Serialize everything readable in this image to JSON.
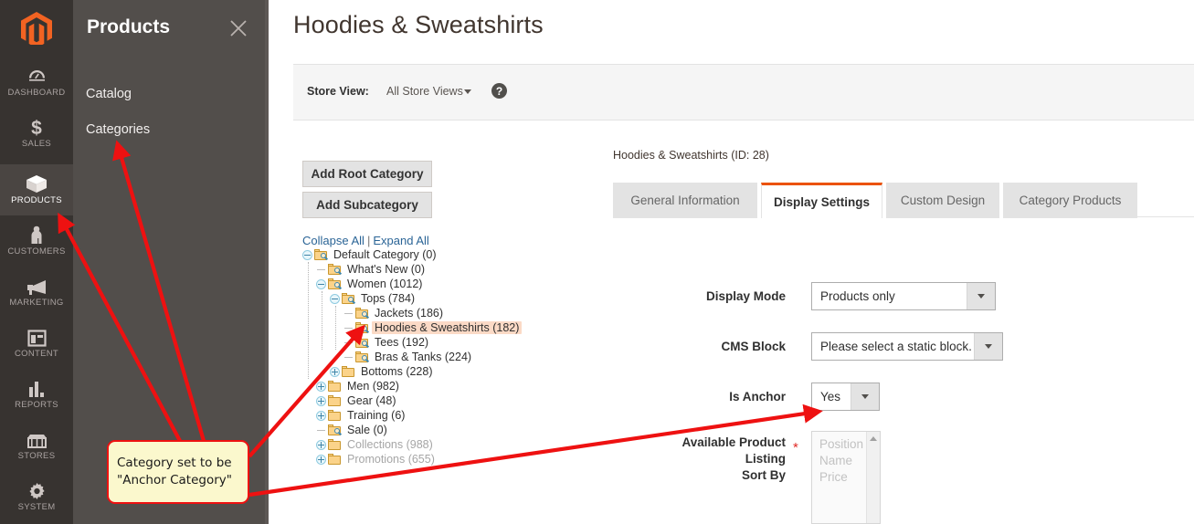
{
  "brand": {
    "accent": "#eb5202",
    "rail_bg": "#373330",
    "flyout_bg": "#524e4b",
    "highlight": "#fbdac6",
    "annotation": "#ee1111"
  },
  "rail": {
    "logo_name": "magento-logo",
    "items": [
      {
        "label": "DASHBOARD",
        "icon": "gauge-icon",
        "active": false
      },
      {
        "label": "SALES",
        "icon": "dollar-icon",
        "active": false
      },
      {
        "label": "PRODUCTS",
        "icon": "box-icon",
        "active": true
      },
      {
        "label": "CUSTOMERS",
        "icon": "person-icon",
        "active": false
      },
      {
        "label": "MARKETING",
        "icon": "megaphone-icon",
        "active": false
      },
      {
        "label": "CONTENT",
        "icon": "layout-icon",
        "active": false
      },
      {
        "label": "REPORTS",
        "icon": "bar-chart-icon",
        "active": false
      },
      {
        "label": "STORES",
        "icon": "storefront-icon",
        "active": false
      },
      {
        "label": "SYSTEM",
        "icon": "gear-icon",
        "active": false
      }
    ]
  },
  "flyout": {
    "title": "Products",
    "close_icon": "close-icon",
    "links": [
      {
        "label": "Catalog"
      },
      {
        "label": "Categories"
      }
    ]
  },
  "header": {
    "page_title": "Hoodies & Sweatshirts",
    "store_view_label": "Store View:",
    "store_view_value": "All Store Views",
    "help_icon": "question-mark-icon",
    "caret_icon": "chevron-down-icon"
  },
  "tree_panel": {
    "add_root_label": "Add Root Category",
    "add_sub_label": "Add Subcategory",
    "collapse_all": "Collapse All",
    "separator": "|",
    "expand_all": "Expand All",
    "nodes": [
      {
        "label": "Default Category (0)",
        "depth": 0,
        "twist": "minus",
        "icon": "folder-search-icon",
        "selected": false,
        "dim": false
      },
      {
        "label": "What's New (0)",
        "depth": 1,
        "twist": "leaf",
        "icon": "folder-search-icon",
        "selected": false,
        "dim": false
      },
      {
        "label": "Women (1012)",
        "depth": 1,
        "twist": "minus",
        "icon": "folder-search-icon",
        "selected": false,
        "dim": false
      },
      {
        "label": "Tops (784)",
        "depth": 2,
        "twist": "minus",
        "icon": "folder-search-icon",
        "selected": false,
        "dim": false
      },
      {
        "label": "Jackets (186)",
        "depth": 3,
        "twist": "leaf",
        "icon": "folder-search-icon",
        "selected": false,
        "dim": false
      },
      {
        "label": "Hoodies & Sweatshirts (182)",
        "depth": 3,
        "twist": "leaf",
        "icon": "folder-search-icon",
        "selected": true,
        "dim": false
      },
      {
        "label": "Tees (192)",
        "depth": 3,
        "twist": "leaf",
        "icon": "folder-search-icon",
        "selected": false,
        "dim": false
      },
      {
        "label": "Bras & Tanks (224)",
        "depth": 3,
        "twist": "leaf",
        "icon": "folder-search-icon",
        "selected": false,
        "dim": false
      },
      {
        "label": "Bottoms (228)",
        "depth": 2,
        "twist": "plus",
        "icon": "folder-icon",
        "selected": false,
        "dim": false
      },
      {
        "label": "Men (982)",
        "depth": 1,
        "twist": "plus",
        "icon": "folder-icon",
        "selected": false,
        "dim": false
      },
      {
        "label": "Gear (48)",
        "depth": 1,
        "twist": "plus",
        "icon": "folder-icon",
        "selected": false,
        "dim": false
      },
      {
        "label": "Training (6)",
        "depth": 1,
        "twist": "plus",
        "icon": "folder-icon",
        "selected": false,
        "dim": false
      },
      {
        "label": "Sale (0)",
        "depth": 1,
        "twist": "leaf",
        "icon": "folder-search-icon",
        "selected": false,
        "dim": false
      },
      {
        "label": "Collections (988)",
        "depth": 1,
        "twist": "plus",
        "icon": "folder-icon",
        "selected": false,
        "dim": true
      },
      {
        "label": "Promotions (655)",
        "depth": 1,
        "twist": "plus",
        "icon": "folder-icon",
        "selected": false,
        "dim": true
      }
    ]
  },
  "form_panel": {
    "category_id_text": "Hoodies & Sweatshirts (ID: 28)",
    "tabs": [
      {
        "label": "General Information",
        "active": false
      },
      {
        "label": "Display Settings",
        "active": true
      },
      {
        "label": "Custom Design",
        "active": false
      },
      {
        "label": "Category Products",
        "active": false
      }
    ],
    "fields": {
      "display_mode": {
        "label": "Display Mode",
        "value": "Products only"
      },
      "cms_block": {
        "label": "CMS Block",
        "value": "Please select a static block."
      },
      "is_anchor": {
        "label": "Is Anchor",
        "value": "Yes"
      },
      "sort_by": {
        "label_line1": "Available Product Listing",
        "label_line2": "Sort By",
        "required_marker": "*",
        "options": [
          "Position",
          "Name",
          "Price"
        ]
      }
    }
  },
  "annotation": {
    "callout_line1": "Category set to be",
    "callout_line2": "\"Anchor Category\"",
    "arrow_count": 4
  }
}
